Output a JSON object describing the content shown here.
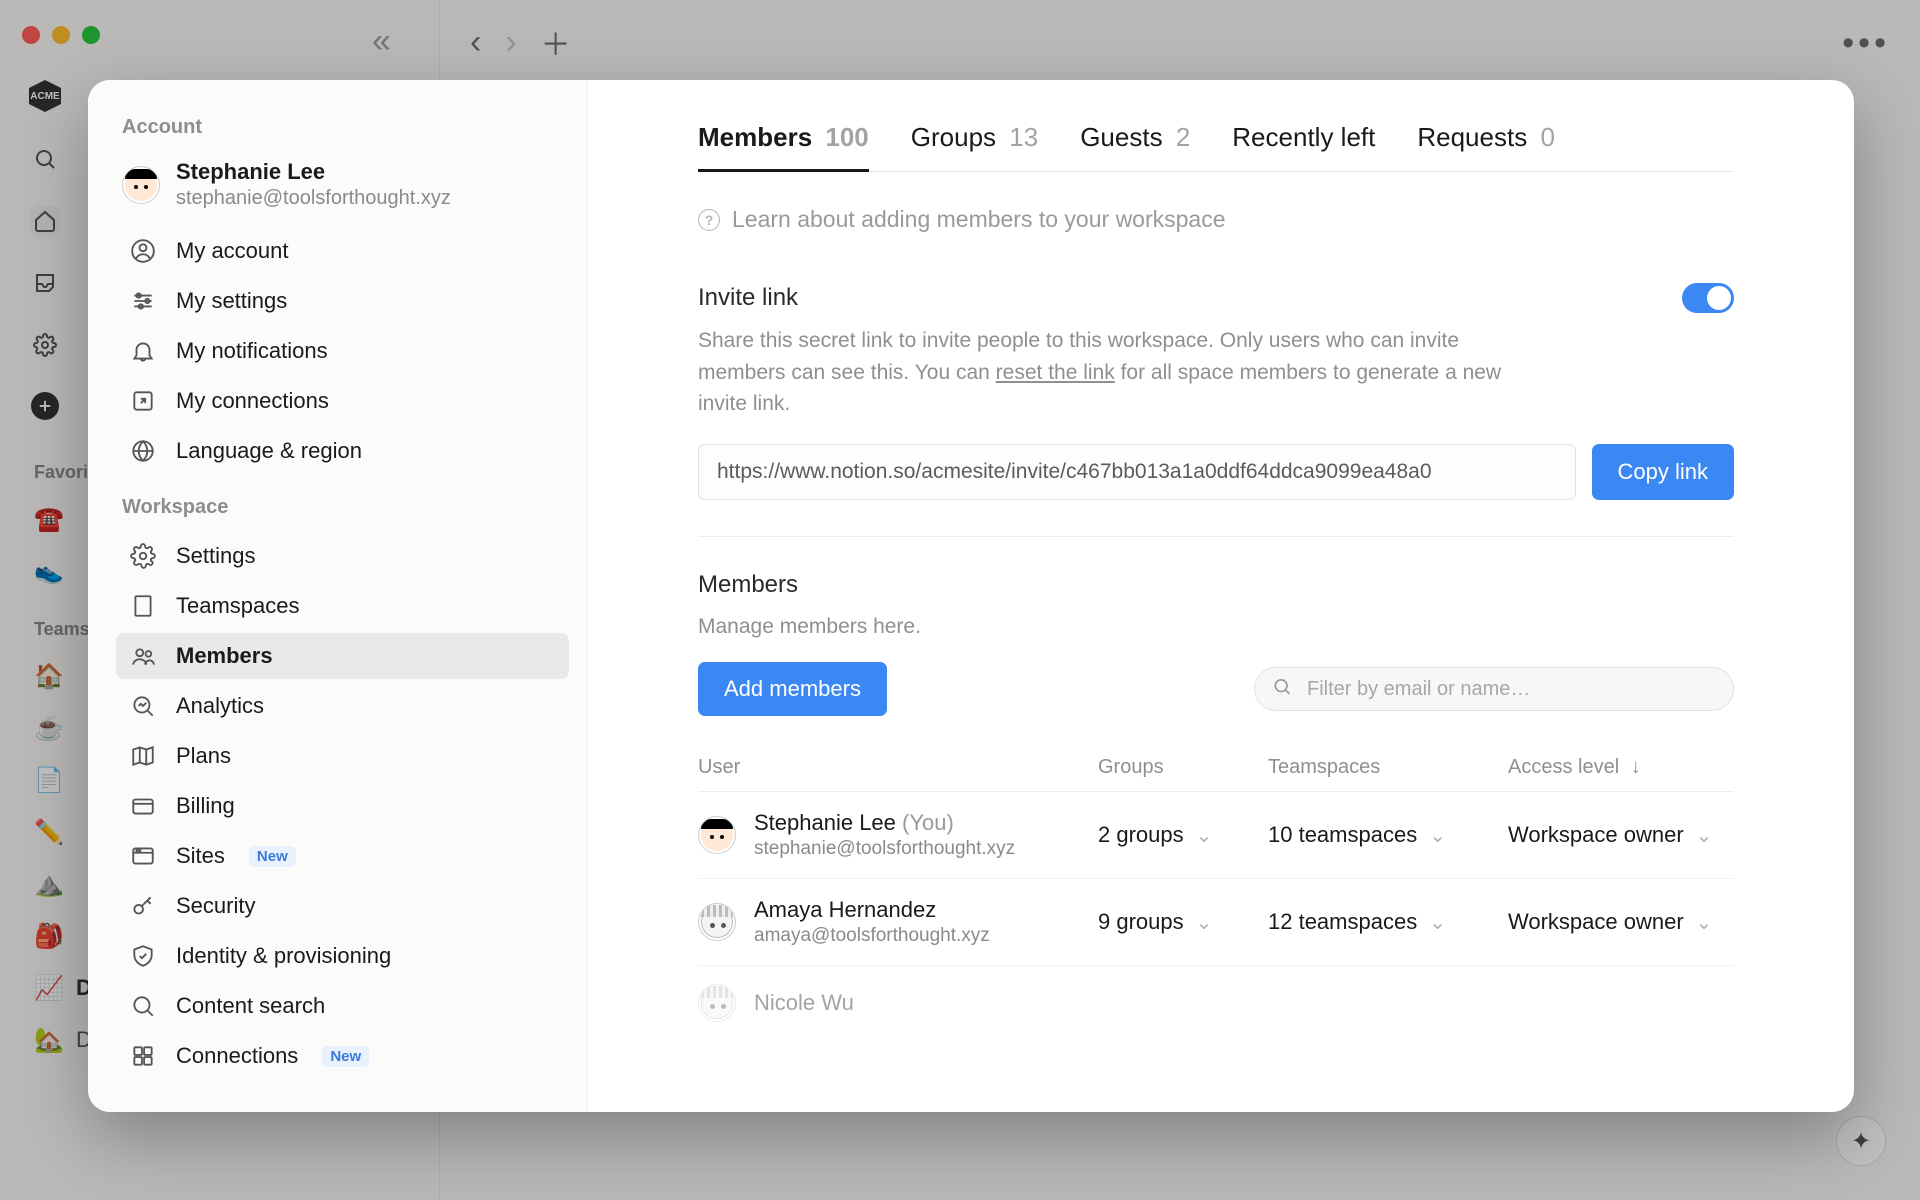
{
  "behind": {
    "favorites_label": "Favorites",
    "teamspaces_label": "Teamspaces",
    "items": [
      {
        "emoji": "☎️",
        "label": ""
      },
      {
        "emoji": "👟",
        "label": ""
      }
    ],
    "ts_items": [
      {
        "emoji": "🏠",
        "label": ""
      },
      {
        "emoji": "☕",
        "label": ""
      },
      {
        "emoji": "📄",
        "label": ""
      },
      {
        "emoji": "✏️",
        "label": ""
      },
      {
        "emoji": "⛰️",
        "label": ""
      },
      {
        "emoji": "🎒",
        "label": ""
      }
    ],
    "data_label": "Data",
    "data_home_label": "Data Home"
  },
  "sidebar": {
    "account_label": "Account",
    "workspace_label": "Workspace",
    "profile": {
      "name": "Stephanie Lee",
      "email": "stephanie@toolsforthought.xyz"
    },
    "account_items": [
      {
        "id": "my-account",
        "label": "My account",
        "icon": "user-circle"
      },
      {
        "id": "my-settings",
        "label": "My settings",
        "icon": "sliders"
      },
      {
        "id": "my-notifications",
        "label": "My notifications",
        "icon": "bell"
      },
      {
        "id": "my-connections",
        "label": "My connections",
        "icon": "arrow-out"
      },
      {
        "id": "language-region",
        "label": "Language & region",
        "icon": "globe"
      }
    ],
    "workspace_items": [
      {
        "id": "settings",
        "label": "Settings",
        "icon": "gear",
        "badge": ""
      },
      {
        "id": "teamspaces",
        "label": "Teamspaces",
        "icon": "building",
        "badge": ""
      },
      {
        "id": "members",
        "label": "Members",
        "icon": "people",
        "badge": "",
        "active": true
      },
      {
        "id": "analytics",
        "label": "Analytics",
        "icon": "chart",
        "badge": ""
      },
      {
        "id": "plans",
        "label": "Plans",
        "icon": "map",
        "badge": ""
      },
      {
        "id": "billing",
        "label": "Billing",
        "icon": "card",
        "badge": ""
      },
      {
        "id": "sites",
        "label": "Sites",
        "icon": "browser",
        "badge": "New"
      },
      {
        "id": "security",
        "label": "Security",
        "icon": "key",
        "badge": ""
      },
      {
        "id": "identity",
        "label": "Identity & provisioning",
        "icon": "shield",
        "badge": ""
      },
      {
        "id": "content-search",
        "label": "Content search",
        "icon": "search",
        "badge": ""
      },
      {
        "id": "connections",
        "label": "Connections",
        "icon": "grid",
        "badge": "New"
      }
    ]
  },
  "tabs": [
    {
      "id": "members",
      "label": "Members",
      "count": "100",
      "active": true
    },
    {
      "id": "groups",
      "label": "Groups",
      "count": "13"
    },
    {
      "id": "guests",
      "label": "Guests",
      "count": "2"
    },
    {
      "id": "recently-left",
      "label": "Recently left",
      "count": ""
    },
    {
      "id": "requests",
      "label": "Requests",
      "count": "0"
    }
  ],
  "learn_text": "Learn about adding members to your workspace",
  "invite": {
    "title": "Invite link",
    "desc1": "Share this secret link to invite people to this workspace. Only users who can invite members can see this. You can ",
    "reset_text": "reset the link",
    "desc2": " for all space members to generate a new invite link.",
    "url": "https://www.notion.so/acmesite/invite/c467bb013a1a0ddf64ddca9099ea48a0",
    "copy_label": "Copy link"
  },
  "members_section": {
    "title": "Members",
    "sub": "Manage members here.",
    "add_label": "Add members",
    "filter_placeholder": "Filter by email or name…",
    "columns": {
      "user": "User",
      "groups": "Groups",
      "teamspaces": "Teamspaces",
      "access": "Access level"
    },
    "rows": [
      {
        "name": "Stephanie Lee",
        "you": "(You)",
        "email": "stephanie@toolsforthought.xyz",
        "groups": "2 groups",
        "teamspaces": "10 teamspaces",
        "access": "Workspace owner",
        "avatar": "face"
      },
      {
        "name": "Amaya Hernandez",
        "you": "",
        "email": "amaya@toolsforthought.xyz",
        "groups": "9 groups",
        "teamspaces": "12 teamspaces",
        "access": "Workspace owner",
        "avatar": "face2"
      }
    ],
    "truncated_name": "Nicole Wu"
  }
}
